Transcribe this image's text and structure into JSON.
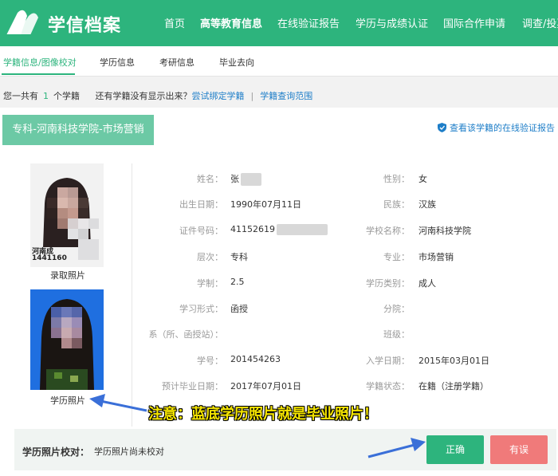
{
  "header": {
    "brand": "学信档案",
    "nav": [
      "首页",
      "高等教育信息",
      "在线验证报告",
      "学历与成绩认证",
      "国际合作申请",
      "调查/投票"
    ],
    "active_nav": "高等教育信息"
  },
  "subnav": {
    "tabs": [
      "学籍信息/图像校对",
      "学历信息",
      "考研信息",
      "毕业去向"
    ]
  },
  "infobar": {
    "prefix": "您一共有",
    "count": "1",
    "suffix": "个学籍",
    "question": "还有学籍没有显示出来？",
    "bind_link": "尝试绑定学籍",
    "scope_link": "学籍查询范围"
  },
  "record": {
    "school_tag": "专科-河南科技学院-市场营销",
    "verify_link": "查看该学籍的在线验证报告",
    "photo1_caption": "录取照片",
    "photo1_id_line1": "河南成",
    "photo1_id_line2": "1441160",
    "photo2_caption": "学历照片",
    "fields_left": [
      {
        "label": "姓名：",
        "value": "张"
      },
      {
        "label": "出生日期：",
        "value": "1990年07月11日"
      },
      {
        "label": "证件号码：",
        "value": "41152619"
      },
      {
        "label": "层次：",
        "value": "专科"
      },
      {
        "label": "学制：",
        "value": "2.5"
      },
      {
        "label": "学习形式：",
        "value": "函授"
      },
      {
        "label": "系（所、函授站）：",
        "value": ""
      },
      {
        "label": "学号：",
        "value": "201454263"
      },
      {
        "label": "预计毕业日期：",
        "value": "2017年07月01日"
      }
    ],
    "fields_right": [
      {
        "label": "性别：",
        "value": "女"
      },
      {
        "label": "民族：",
        "value": "汉族"
      },
      {
        "label": "学校名称：",
        "value": "河南科技学院"
      },
      {
        "label": "专业：",
        "value": "市场营销"
      },
      {
        "label": "学历类别：",
        "value": "成人"
      },
      {
        "label": "分院：",
        "value": ""
      },
      {
        "label": "班级：",
        "value": ""
      },
      {
        "label": "入学日期：",
        "value": "2015年03月01日"
      },
      {
        "label": "学籍状态：",
        "value": "在籍（注册学籍）"
      }
    ]
  },
  "annotation": "注意：蓝底学历照片就是毕业照片！",
  "photo_check": {
    "label": "学历照片校对：",
    "value": "学历照片尚未校对",
    "confirm_button": "正确",
    "error_button": "有误"
  },
  "colors": {
    "brand_green": "#2db47d",
    "tag_green": "#6cc9a5",
    "link_blue": "#1e7ec8",
    "error_red": "#f07a7a",
    "photo_blue": "#1f6fe0",
    "note_yellow": "#f6e600"
  }
}
